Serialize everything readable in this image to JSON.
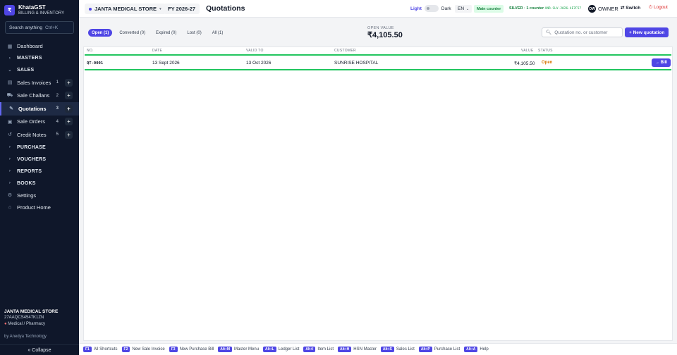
{
  "brand": {
    "logo": "₹",
    "title": "KhataGST",
    "subtitle": "BILLING & INVENTORY"
  },
  "sidebar": {
    "search_placeholder": "Search anything",
    "search_shortcut": "Ctrl+K",
    "dashboard": "Dashboard",
    "masters": "MASTERS",
    "sales": "SALES",
    "sales_items": [
      {
        "label": "Sales Invoices",
        "count": "1"
      },
      {
        "label": "Sale Challans",
        "count": "2"
      },
      {
        "label": "Quotations",
        "count": "3"
      },
      {
        "label": "Sale Orders",
        "count": "4"
      },
      {
        "label": "Credit Notes",
        "count": "5"
      }
    ],
    "purchase": "PURCHASE",
    "vouchers": "VOUCHERS",
    "reports": "REPORTS",
    "books": "BOOKS",
    "settings": "Settings",
    "product_home": "Product Home",
    "store_name": "JANTA MEDICAL STORE",
    "gstin": "27AAQCS4547K1ZN",
    "store_type": "Medical / Pharmacy",
    "by_line": "by Anedya Technology",
    "collapse": "« Collapse"
  },
  "topbar": {
    "store": "JANTA MEDICAL STORE",
    "fy": "FY 2026-27",
    "title": "Quotations",
    "light": "Light",
    "dark": "Dark",
    "lang": "EN",
    "counter": "Main counter",
    "plan": "SILVER · 1 counter",
    "license_key": "ANR-SLV-2026-4E7F57",
    "avatar": "OW",
    "owner": "OWNER",
    "switch": "Switch",
    "logout": "Logout"
  },
  "filters": {
    "tabs": [
      "Open (1)",
      "Converted (0)",
      "Expired (0)",
      "Lost (0)",
      "All (1)"
    ],
    "open_value_label": "OPEN VALUE",
    "open_value": "₹4,105.50",
    "search_placeholder": "Quotation no. or customer",
    "new_button": "+ New quotation"
  },
  "table": {
    "headers": {
      "no": "NO.",
      "date": "DATE",
      "valid_to": "VALID TO",
      "customer": "CUSTOMER",
      "value": "VALUE",
      "status": "STATUS"
    },
    "rows": [
      {
        "no": "QT-0001",
        "date": "13 Sept 2026",
        "valid_to": "13 Oct 2026",
        "customer": "SUNRISE HOSPITAL",
        "value": "₹4,105.50",
        "status": "Open",
        "action": "→ Bill"
      }
    ]
  },
  "shortcuts": [
    {
      "key": "F1",
      "label": "All Shortcuts"
    },
    {
      "key": "F2",
      "label": "New Sale Invoice"
    },
    {
      "key": "F3",
      "label": "New Purchase Bill"
    },
    {
      "key": "Alt+M",
      "label": "Master Menu"
    },
    {
      "key": "Alt+L",
      "label": "Ledger List"
    },
    {
      "key": "Alt+I",
      "label": "Item List"
    },
    {
      "key": "Alt+H",
      "label": "HSN Master"
    },
    {
      "key": "Alt+S",
      "label": "Sales List"
    },
    {
      "key": "Alt+P",
      "label": "Purchase List"
    },
    {
      "key": "Alt+A",
      "label": "Help"
    }
  ]
}
